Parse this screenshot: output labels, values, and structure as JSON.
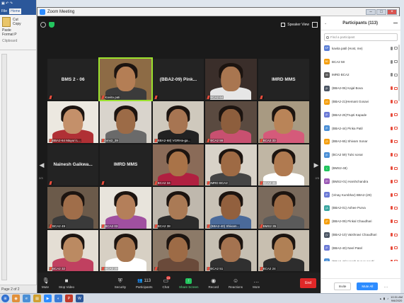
{
  "word": {
    "title": "",
    "tabs": [
      "File",
      "Home"
    ],
    "ribbon": {
      "paste": "Paste",
      "cut": "Cut",
      "copy": "Copy",
      "format_painter": "Format P",
      "group": "Clipboard"
    },
    "status": "Page 2 of 2"
  },
  "zoom": {
    "title": "Zoom Meeting",
    "speaker_view": "Speaker View",
    "page_left": "2/3",
    "page_right": "2/3"
  },
  "tiles": [
    {
      "name": "BMS 2 - 06",
      "label": "",
      "kind": "name",
      "color": "#232323"
    },
    {
      "name": "",
      "label": "Kavita pati",
      "kind": "video",
      "skin": "#b47e55",
      "shirt": "#3b3b3b",
      "bg": "#8d6b45",
      "active": true
    },
    {
      "name": "(BBA2-09) Pink...",
      "label": "",
      "kind": "name"
    },
    {
      "name": "",
      "label": "BCA2 64",
      "kind": "video",
      "skin": "#a97650",
      "shirt": "#e6e6e6",
      "bg": "#3a2e2a"
    },
    {
      "name": "IMRD MMS",
      "label": "",
      "kind": "name"
    },
    {
      "name": "",
      "label": "BBA2-64 Mayuri L...",
      "kind": "video",
      "skin": "#c4906a",
      "shirt": "#b03035",
      "bg": "#ece8e0"
    },
    {
      "name": "",
      "label": "bms2_39",
      "kind": "video",
      "skin": "#9c6b47",
      "shirt": "#6a6a6a",
      "bg": "#d9d4cc"
    },
    {
      "name": "",
      "label": "BBA2-68) VGRHa-ga...",
      "kind": "video",
      "skin": "#a77552",
      "shirt": "#222222",
      "bg": "#cfc9bd"
    },
    {
      "name": "",
      "label": "BCA2 56",
      "kind": "video",
      "skin": "#8d5e3d",
      "shirt": "#c85070",
      "bg": "#5a4a40"
    },
    {
      "name": "",
      "label": "BCA2 33",
      "kind": "video",
      "skin": "#b98458",
      "shirt": "#d55a7a",
      "bg": "#a89a82"
    },
    {
      "name": "Nainesh Gaikwa...",
      "label": "",
      "kind": "name"
    },
    {
      "name": "IMRD MMS",
      "label": "",
      "kind": "name"
    },
    {
      "name": "",
      "label": "BCA2 34",
      "kind": "video",
      "skin": "#a97348",
      "shirt": "#b02040",
      "bg": "#8a6b58"
    },
    {
      "name": "",
      "label": "IMRD BCA2",
      "kind": "video",
      "skin": "#9e6a44",
      "shirt": "#444444",
      "bg": "#d8d2c8"
    },
    {
      "name": "",
      "label": "BCA2 46",
      "kind": "video",
      "skin": "#b07a50",
      "shirt": "#ffffff",
      "bg": "#c0b6a4"
    },
    {
      "name": "",
      "label": "BCA2 49",
      "kind": "video",
      "skin": "#a06e4a",
      "shirt": "#3a3a3a",
      "bg": "#6b5a4a"
    },
    {
      "name": "",
      "label": "BCA2 03",
      "kind": "video",
      "skin": "#b47f5a",
      "shirt": "#a050a0",
      "bg": "#e8e4dc"
    },
    {
      "name": "",
      "label": "BCA2 38",
      "kind": "video",
      "skin": "#aa7a55",
      "shirt": "#2b2b2b",
      "bg": "#bfb8ad"
    },
    {
      "name": "",
      "label": "(BBA2-40) Shivam...",
      "kind": "video",
      "skin": "#92603e",
      "shirt": "#4a6a9a",
      "bg": "#c9c2b6"
    },
    {
      "name": "",
      "label": "BMS2 35",
      "kind": "video",
      "skin": "#9c6a44",
      "shirt": "#5a5a5a",
      "bg": "#7a6a5c"
    },
    {
      "name": "",
      "label": "BCA2 32",
      "kind": "video",
      "skin": "#bb8a62",
      "shirt": "#c04060",
      "bg": "#e4ded4"
    },
    {
      "name": "",
      "label": "BCA2 20",
      "kind": "video",
      "skin": "#a87852",
      "shirt": "#ffffff",
      "bg": "#d7d0c4"
    },
    {
      "name": "",
      "label": "",
      "kind": "video",
      "skin": "#9d6b46",
      "shirt": "#6a4a3a",
      "bg": "#8c7a68"
    },
    {
      "name": "",
      "label": "BCA2 51",
      "kind": "video",
      "skin": "#a47350",
      "shirt": "#303030",
      "bg": "#c6bfb2"
    },
    {
      "name": "",
      "label": "BCA2 24",
      "kind": "video",
      "skin": "#b08055",
      "shirt": "#2d2d2d",
      "bg": "#c8bfb0"
    }
  ],
  "toolbar": {
    "mute": "Mute",
    "stop_video": "Stop Video",
    "security": "Security",
    "participants": "Participants",
    "participants_count": "113",
    "chat": "Chat",
    "chat_badge": "19",
    "share_screen": "Share Screen",
    "record": "Record",
    "reactions": "Reactions",
    "more": "More",
    "end": "End"
  },
  "participants": {
    "title": "Participants (113)",
    "search_placeholder": "Find a participant",
    "list": [
      {
        "initials": "KP",
        "name": "kavita patil (Host, me)",
        "color": "#5b7fd6",
        "muted": false
      },
      {
        "initials": "BC",
        "name": "BCA2 58",
        "color": "#f59e0b",
        "muted": false
      },
      {
        "initials": "IB",
        "name": "IMRD BCA2",
        "color": "#555555",
        "muted": false
      },
      {
        "initials": "(K",
        "name": "(BBA2-06) Kajal Bova",
        "color": "#4b5563",
        "muted": true
      },
      {
        "initials": "(G",
        "name": "(BBA2-21)Hemant Gosavi",
        "color": "#f59e0b",
        "muted": true
      },
      {
        "initials": "(K",
        "name": "(BBA2-25)Trupti Kapade",
        "color": "#6b7ad6",
        "muted": true
      },
      {
        "initials": "(K",
        "name": "(BBA2-44) Pinka Patil",
        "color": "#4a8fd6",
        "muted": true
      },
      {
        "initials": "(S",
        "name": "(BBA2-65) Shivam Sonar",
        "color": "#f59e0b",
        "muted": true
      },
      {
        "initials": "(K",
        "name": "(BCA2 59) Tulsi sonar",
        "color": "#4a8fd6",
        "muted": true
      },
      {
        "initials": "(",
        "name": "(BMS2-48)",
        "color": "#22c55e",
        "muted": true
      },
      {
        "initials": "(H",
        "name": "(BMS2-01) Harshchandra",
        "color": "#9b59b6",
        "muted": true
      },
      {
        "initials": "(K",
        "name": "(Vinay Kumbhar) BBA2-(29)",
        "color": "#6b7ad6",
        "muted": true
      },
      {
        "initials": "(A",
        "name": "(BBA2-01) Ashee Purva",
        "color": "#3aa6a0",
        "muted": true
      },
      {
        "initials": "(P",
        "name": "(BBA2-09) Pinkal Chaudhari",
        "color": "#f59e0b",
        "muted": true
      },
      {
        "initials": "(V",
        "name": "(BBA2-10) Vaishnavi Chaudhari",
        "color": "#4b5563",
        "muted": true
      },
      {
        "initials": "(K",
        "name": "(BBA2-40) Neel Patel",
        "color": "#6b7ad6",
        "muted": true
      },
      {
        "initials": "(S",
        "name": "(BBA2-42) Harsh Suryavanshi",
        "color": "#4a8fd6",
        "muted": true
      }
    ],
    "invite": "Invite",
    "mute_all": "Mute All"
  },
  "taskbar": {
    "time": "10:31 AM",
    "date": "9/6/2020"
  }
}
